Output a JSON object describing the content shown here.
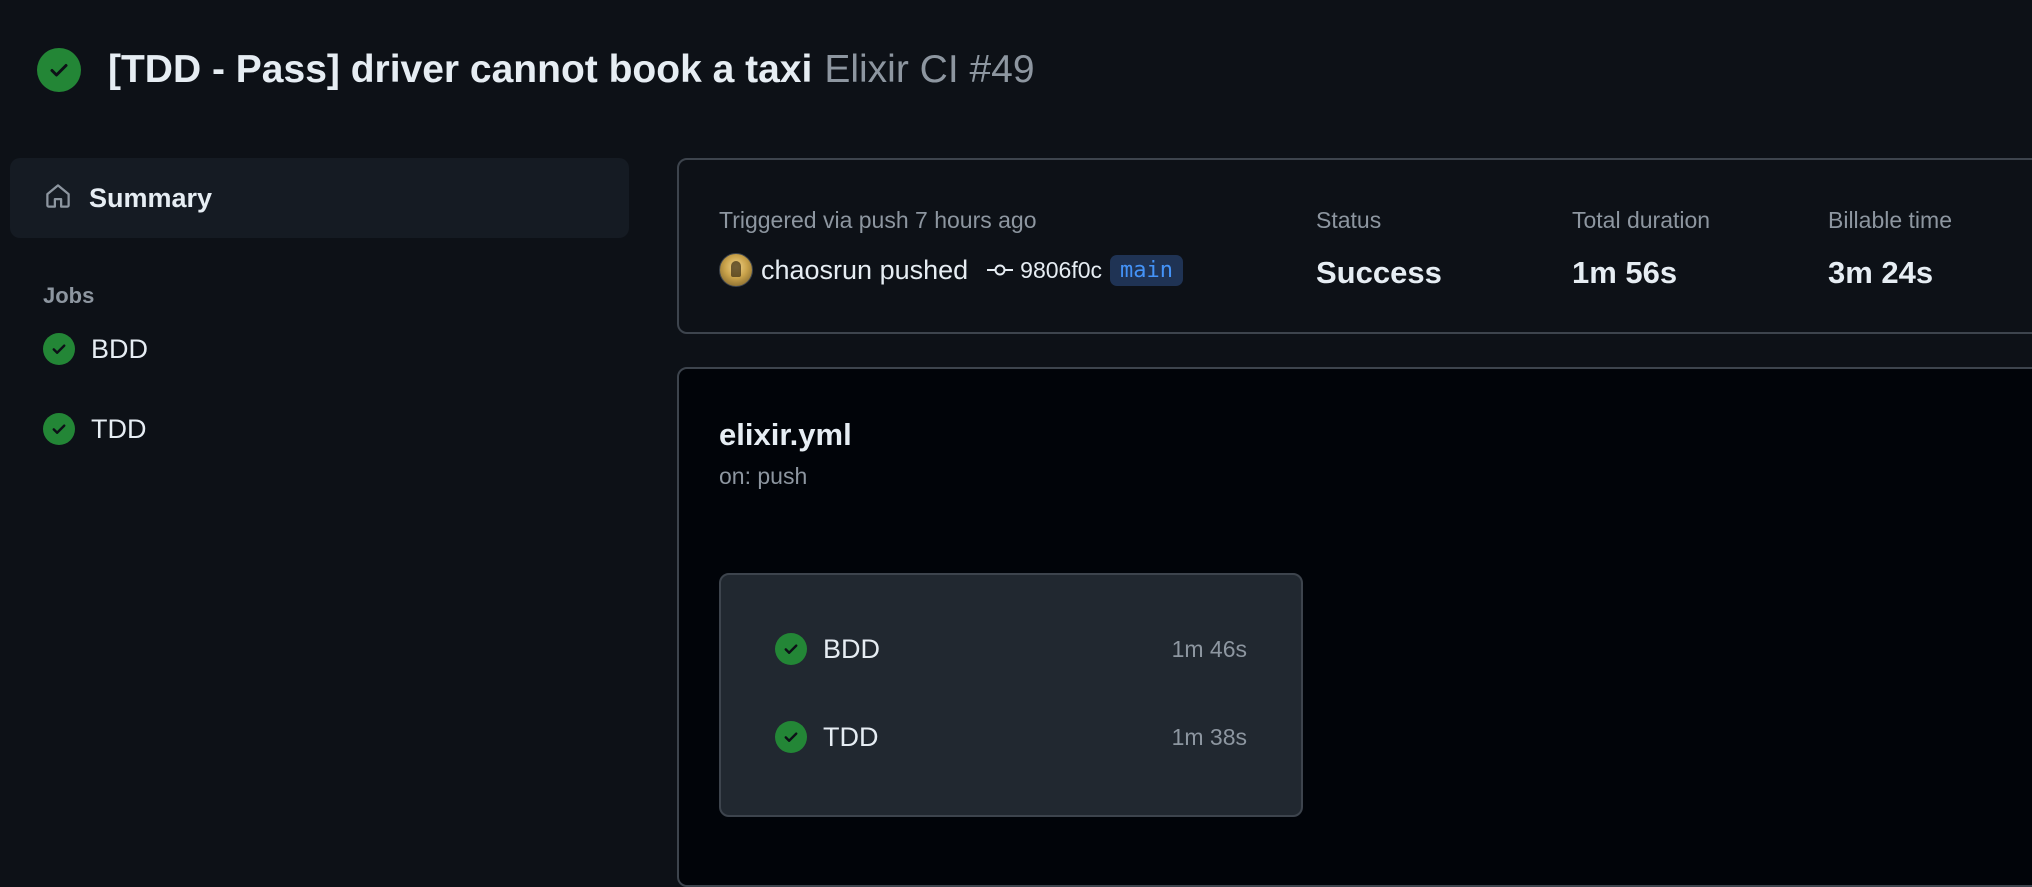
{
  "header": {
    "status_icon": "check-circle-fill-icon",
    "title": "[TDD - Pass] driver cannot book a taxi",
    "workflow_run": "Elixir CI #49"
  },
  "sidebar": {
    "summary_label": "Summary",
    "summary_icon": "home-icon",
    "jobs_heading": "Jobs",
    "jobs": [
      {
        "label": "BDD",
        "status_icon": "check-circle-fill-icon"
      },
      {
        "label": "TDD",
        "status_icon": "check-circle-fill-icon"
      }
    ]
  },
  "run_info": {
    "trigger_text": "Triggered via push 7 hours ago",
    "pusher": "chaosrun pushed",
    "commit_icon": "git-commit-icon",
    "commit_sha": "9806f0c",
    "branch": "main",
    "status_label": "Status",
    "status_value": "Success",
    "duration_label": "Total duration",
    "duration_value": "1m 56s",
    "billable_label": "Billable time",
    "billable_value": "3m 24s"
  },
  "workflow_graph": {
    "file_name": "elixir.yml",
    "trigger": "on: push",
    "jobs": [
      {
        "name": "BDD",
        "duration": "1m 46s",
        "status_icon": "check-circle-fill-icon"
      },
      {
        "name": "TDD",
        "duration": "1m 38s",
        "status_icon": "check-circle-fill-icon"
      }
    ]
  },
  "colors": {
    "background": "#0d1117",
    "success": "#238636",
    "border": "#3d444d",
    "muted_text": "#8d96a0",
    "branch_text": "#4493f8",
    "branch_bg": "#1f3354"
  }
}
